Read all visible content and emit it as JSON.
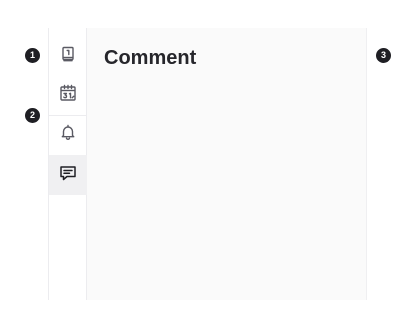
{
  "callouts": [
    "1",
    "2",
    "3"
  ],
  "rail": {
    "items": [
      {
        "name": "book",
        "icon": "book-icon",
        "active": false
      },
      {
        "name": "calendar",
        "icon": "calendar-icon",
        "active": false
      },
      {
        "name": "notifications",
        "icon": "bell-icon",
        "active": false
      },
      {
        "name": "comment",
        "icon": "comment-icon",
        "active": true
      }
    ]
  },
  "panel": {
    "title": "Comment"
  },
  "colors": {
    "icon": "#5a5a63",
    "active_icon": "#1f1f24",
    "active_bg": "#f0f0f2",
    "panel_bg": "#fafafa",
    "callout_bg": "#1f1f24"
  }
}
